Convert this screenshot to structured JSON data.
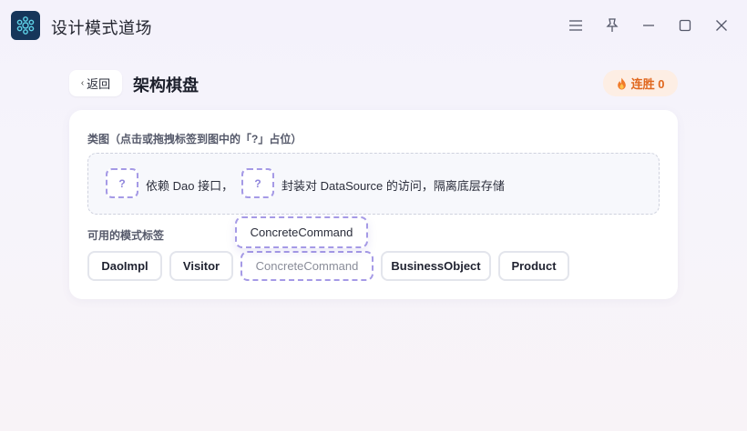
{
  "window": {
    "title": "设计模式道场",
    "controls": [
      "menu-icon",
      "pin-icon",
      "minimize-icon",
      "maximize-icon",
      "close-icon"
    ]
  },
  "header": {
    "back_label": "返回",
    "back_chevron": "‹",
    "page_title": "架构棋盘",
    "streak_label": "连胜 0"
  },
  "diagram": {
    "section_label": "类图（点击或拖拽标签到图中的「?」占位）",
    "slot_placeholder": "?",
    "segment_1": "依赖 Dao 接口，",
    "segment_2": "封装对 DataSource 的访问，隔离底层存储"
  },
  "available": {
    "label": "可用的模式标签",
    "chips": [
      "DaoImpl",
      "Visitor",
      "ConcreteCommand",
      "BusinessObject",
      "Product"
    ],
    "dragging": "ConcreteCommand"
  },
  "colors": {
    "accent": "#a59ae6",
    "streak": "#e0671e",
    "logo_bg": "#16365a"
  }
}
